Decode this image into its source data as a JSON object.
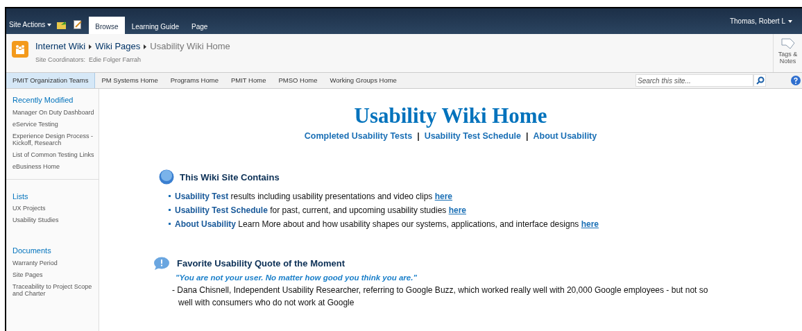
{
  "ribbon": {
    "site_actions": "Site Actions",
    "tabs": [
      {
        "label": "Browse",
        "selected": true
      },
      {
        "label": "Learning Guide",
        "selected": false
      },
      {
        "label": "Page",
        "selected": false
      }
    ],
    "user": "Thomas, Robert L"
  },
  "title_area": {
    "breadcrumb": [
      "Internet Wiki",
      "Wiki Pages"
    ],
    "current": "Usability Wiki Home",
    "coordinators_label": "Site Coordinators:",
    "coordinators": "Edie Folger Farrah",
    "tags_notes": "Tags & Notes"
  },
  "top_nav": {
    "items": [
      {
        "label": "PMIT Organization Teams",
        "selected": true
      },
      {
        "label": "PM Systems Home",
        "selected": false
      },
      {
        "label": "Programs Home",
        "selected": false
      },
      {
        "label": "PMIT Home",
        "selected": false
      },
      {
        "label": "PMSO Home",
        "selected": false
      },
      {
        "label": "Working Groups Home",
        "selected": false
      }
    ],
    "search": {
      "placeholder": "Search this site..."
    }
  },
  "sidebar": {
    "sections": [
      {
        "heading": "Recently Modified",
        "items": [
          "Manager On Duty Dashboard",
          "eService Testing",
          "Experience Design Process - Kickoff, Research",
          "List of Common Testing Links",
          "eBusiness Home"
        ]
      },
      {
        "heading": "Lists",
        "items": [
          "UX Projects",
          "Usability Studies"
        ]
      },
      {
        "heading": "Documents",
        "items": [
          "Warranty Period",
          "Site Pages",
          "Traceability to Project Scope and Charter"
        ]
      }
    ]
  },
  "content": {
    "title": "Usability Wiki Home",
    "links": [
      "Completed Usability Tests",
      "Usability Test Schedule",
      "About Usability"
    ],
    "separator": "|",
    "contains": {
      "heading": "This Wiki Site Contains",
      "items": [
        {
          "title": "Usability Test",
          "text": "results including usability presentations and video clips",
          "link": "here"
        },
        {
          "title": "Usability Test Schedule",
          "text": "for past, current, and upcoming usability studies",
          "link": "here"
        },
        {
          "title": "About Usability",
          "text": "Learn More about and how usability shapes our systems, applications, and interface designs",
          "link": "here"
        }
      ]
    },
    "quote": {
      "heading": "Favorite Usability Quote of the Moment",
      "quote": "\"You are not your user. No matter how good you think you are.\"",
      "attribution": "- Dana Chisnell, Independent Usability Researcher, referring to Google Buzz, which worked really well with 20,000 Google employees - but not so well with consumers who do not work at Google"
    }
  }
}
